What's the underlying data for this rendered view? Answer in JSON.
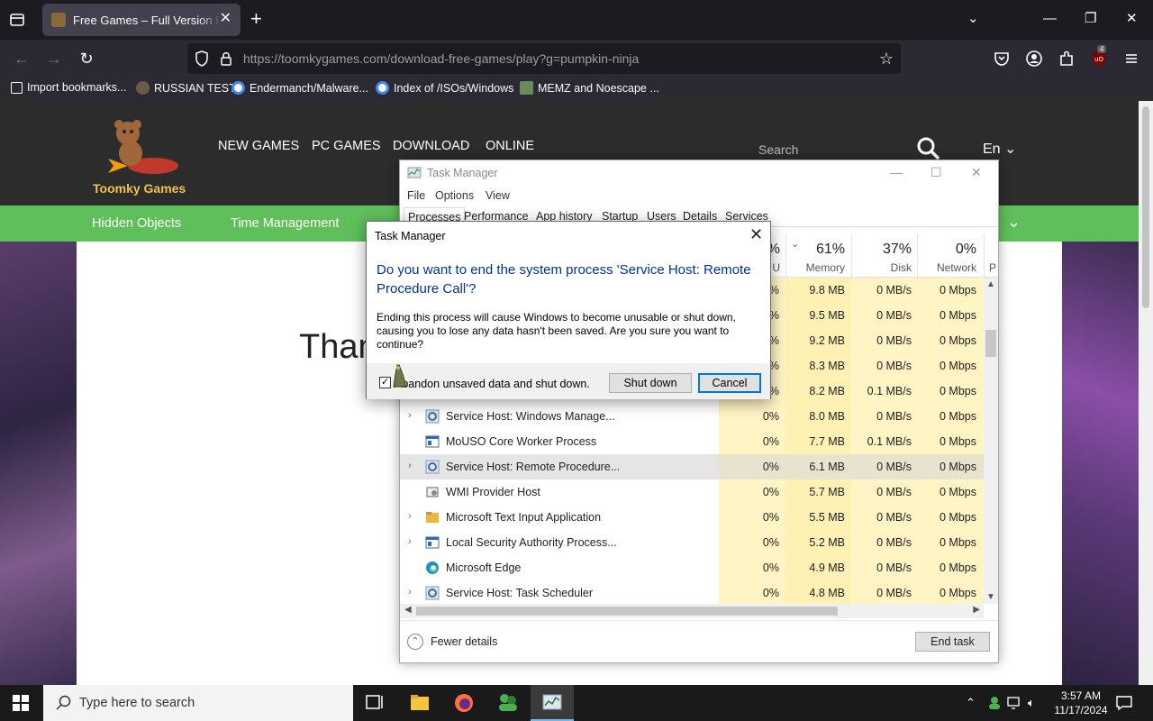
{
  "browser": {
    "tab_title": "Free Games – Full Version PC Games",
    "url_host": "https://toomkygames.com",
    "url_path": "/download-free-games/play?g=pumpkin-ninja",
    "ublock_count": "4",
    "bookmarks": [
      {
        "label": "Import bookmarks..."
      },
      {
        "label": "RUSSIAN TEST"
      },
      {
        "label": "Endermanch/Malware..."
      },
      {
        "label": "Index of /ISOs/Windows"
      },
      {
        "label": "MEMZ and Noescape ..."
      }
    ]
  },
  "site": {
    "logo_text": "Toomky Games",
    "nav": [
      "NEW GAMES",
      "PC GAMES",
      "DOWNLOAD",
      "ONLINE"
    ],
    "search_placeholder": "Search",
    "language": "En",
    "categories": [
      "Hidden Objects",
      "Time Management"
    ],
    "body_text": "Than"
  },
  "task_manager": {
    "title": "Task Manager",
    "menu": [
      "File",
      "Options",
      "View"
    ],
    "tabs": [
      "Processes",
      "Performance",
      "App history",
      "Startup",
      "Users",
      "Details",
      "Services"
    ],
    "columns": {
      "cpu": {
        "pct": "%",
        "label": "U"
      },
      "memory": {
        "pct": "61%",
        "label": "Memory"
      },
      "disk": {
        "pct": "37%",
        "label": "Disk"
      },
      "network": {
        "pct": "0%",
        "label": "Network"
      },
      "power": {
        "label": "P"
      }
    },
    "rows": [
      {
        "name": "",
        "cpu": "%",
        "mem": "9.8 MB",
        "disk": "0 MB/s",
        "net": "0 Mbps",
        "expand": false,
        "icon": "none"
      },
      {
        "name": "",
        "cpu": "%",
        "mem": "9.5 MB",
        "disk": "0 MB/s",
        "net": "0 Mbps",
        "expand": false,
        "icon": "none"
      },
      {
        "name": "",
        "cpu": "%",
        "mem": "9.2 MB",
        "disk": "0 MB/s",
        "net": "0 Mbps",
        "expand": false,
        "icon": "none"
      },
      {
        "name": "",
        "cpu": "%",
        "mem": "8.3 MB",
        "disk": "0 MB/s",
        "net": "0 Mbps",
        "expand": false,
        "icon": "none"
      },
      {
        "name": "",
        "cpu": "%",
        "mem": "8.2 MB",
        "disk": "0.1 MB/s",
        "net": "0 Mbps",
        "expand": false,
        "icon": "none"
      },
      {
        "name": "Service Host: Windows Manage...",
        "cpu": "0%",
        "mem": "8.0 MB",
        "disk": "0 MB/s",
        "net": "0 Mbps",
        "expand": true,
        "icon": "gear"
      },
      {
        "name": "MoUSO Core Worker Process",
        "cpu": "0%",
        "mem": "7.7 MB",
        "disk": "0.1 MB/s",
        "net": "0 Mbps",
        "expand": false,
        "icon": "window"
      },
      {
        "name": "Service Host: Remote Procedure...",
        "cpu": "0%",
        "mem": "6.1 MB",
        "disk": "0 MB/s",
        "net": "0 Mbps",
        "expand": true,
        "icon": "gear",
        "selected": true
      },
      {
        "name": "WMI Provider Host",
        "cpu": "0%",
        "mem": "5.7 MB",
        "disk": "0 MB/s",
        "net": "0 Mbps",
        "expand": false,
        "icon": "wmi"
      },
      {
        "name": "Microsoft Text Input Application",
        "cpu": "0%",
        "mem": "5.5 MB",
        "disk": "0 MB/s",
        "net": "0 Mbps",
        "expand": true,
        "icon": "folder"
      },
      {
        "name": "Local Security Authority Process...",
        "cpu": "0%",
        "mem": "5.2 MB",
        "disk": "0 MB/s",
        "net": "0 Mbps",
        "expand": true,
        "icon": "window"
      },
      {
        "name": "Microsoft Edge",
        "cpu": "0%",
        "mem": "4.9 MB",
        "disk": "0 MB/s",
        "net": "0 Mbps",
        "expand": false,
        "icon": "edge"
      },
      {
        "name": "Service Host: Task Scheduler",
        "cpu": "0%",
        "mem": "4.8 MB",
        "disk": "0 MB/s",
        "net": "0 Mbps",
        "expand": true,
        "icon": "gear"
      }
    ],
    "fewer_details": "Fewer details",
    "end_task": "End task"
  },
  "dialog": {
    "title": "Task Manager",
    "heading": "Do you want to end the system process 'Service Host: Remote Procedure Call'?",
    "body": "Ending this process will cause Windows to become unusable or shut down, causing you to lose any data hasn't been saved. Are you sure you want to continue?",
    "checkbox_label": "Abandon unsaved data and shut down.",
    "checkbox_checked": true,
    "shutdown_label": "Shut down",
    "cancel_label": "Cancel"
  },
  "taskbar": {
    "search_placeholder": "Type here to search",
    "time": "3:57 AM",
    "date": "11/17/2024"
  }
}
